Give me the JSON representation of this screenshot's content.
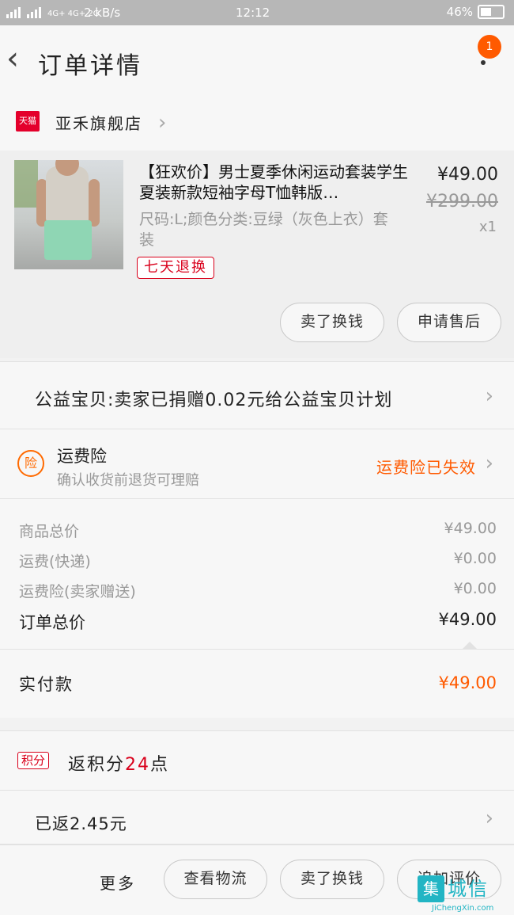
{
  "status_bar": {
    "network_1": "2G",
    "network_2": "4G+ 4G+ 2G",
    "speed": "2 kB/s",
    "time": "12:12",
    "battery": "46%"
  },
  "nav": {
    "title": "订单详情",
    "badge_count": "1"
  },
  "shop": {
    "tmall_logo": "天猫",
    "name": "亚禾旗舰店"
  },
  "product": {
    "title": "【狂欢价】男士夏季休闲运动套装学生夏装新款短袖字母T恤韩版…",
    "sku": "尺码:L;颜色分类:豆绿（灰色上衣）套装",
    "price": "¥49.00",
    "original_price": "¥299.00",
    "quantity": "x1",
    "return_tag": "七天退换",
    "actions": [
      "卖了换钱",
      "申请售后"
    ]
  },
  "charity": {
    "text": "公益宝贝:卖家已捐赠0.02元给公益宝贝计划"
  },
  "insurance": {
    "icon": "险",
    "title": "运费险",
    "subtitle": "确认收货前退货可理赔",
    "status": "运费险已失效"
  },
  "fees": [
    {
      "label": "商品总价",
      "value": "¥49.00"
    },
    {
      "label": "运费(快递)",
      "value": "¥0.00"
    },
    {
      "label": "运费险(卖家赠送)",
      "value": "¥0.00"
    },
    {
      "label": "订单总价",
      "value": "¥49.00"
    }
  ],
  "paid": {
    "label": "实付款",
    "value": "¥49.00"
  },
  "points": {
    "tag": "积分",
    "prefix": "返积分",
    "value": "24",
    "suffix": "点"
  },
  "rebate": {
    "text": "已返2.45元"
  },
  "bottom_bar": {
    "more": "更多",
    "buttons": [
      "查看物流",
      "卖了换钱",
      "追加评价"
    ]
  },
  "watermark": {
    "logo": "集",
    "text": "城信",
    "url": "JiChengXin.com"
  },
  "colors": {
    "accent_orange": "#ff5a00",
    "tmall_red": "#e4002b",
    "tag_red": "#d9001b"
  }
}
